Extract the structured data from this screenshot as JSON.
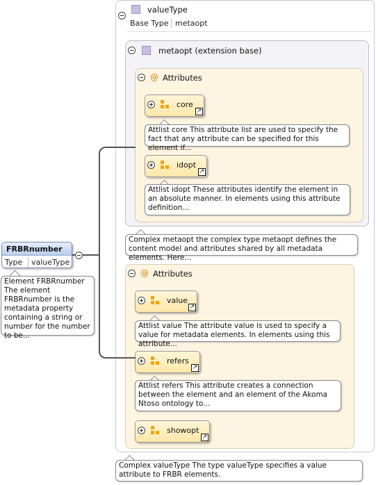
{
  "valuetype": {
    "title": "valueType",
    "base_type_label": "Base Type",
    "base_type_value": "metaopt",
    "note": "Complex valueType The type valueType specifies a value attribute to FRBR elements."
  },
  "metaopt": {
    "title": "metaopt (extension base)",
    "note": "Complex metaopt the complex type metaopt defines the content model and attributes shared by all metadata elements. Here..."
  },
  "inner_attributes": {
    "title": "Attributes",
    "items": [
      {
        "label": "core",
        "note": "Attlist core This attribute list are used to specify the fact that any attribute can be specified for this element if..."
      },
      {
        "label": "idopt",
        "note": "Attlist idopt These attributes identify the element in an absolute manner. In elements using this attribute definition..."
      }
    ]
  },
  "outer_attributes": {
    "title": "Attributes",
    "items": [
      {
        "label": "value",
        "note": "Attlist value The attribute value is used to specify a value for metadata elements. In elements using this attribute..."
      },
      {
        "label": "refers",
        "note": "Attlist refers This attribute creates a connection between the element and an element of the Akoma Ntoso ontology to..."
      },
      {
        "label": "showopt",
        "note": ""
      }
    ]
  },
  "element": {
    "name": "FRBRnumber",
    "type_label": "Type",
    "type_value": "valueType",
    "note": "Element FRBRnumber The element FRBRnumber is the metadata property containing a string or number for the number to be..."
  },
  "colors": {
    "purple_bg": "#f3f2f6",
    "cream_bg": "#fdf4e2",
    "attr_fill": "#fde7a8",
    "element_header": "#c9d8f0",
    "attr_icon": "#f0a500"
  }
}
